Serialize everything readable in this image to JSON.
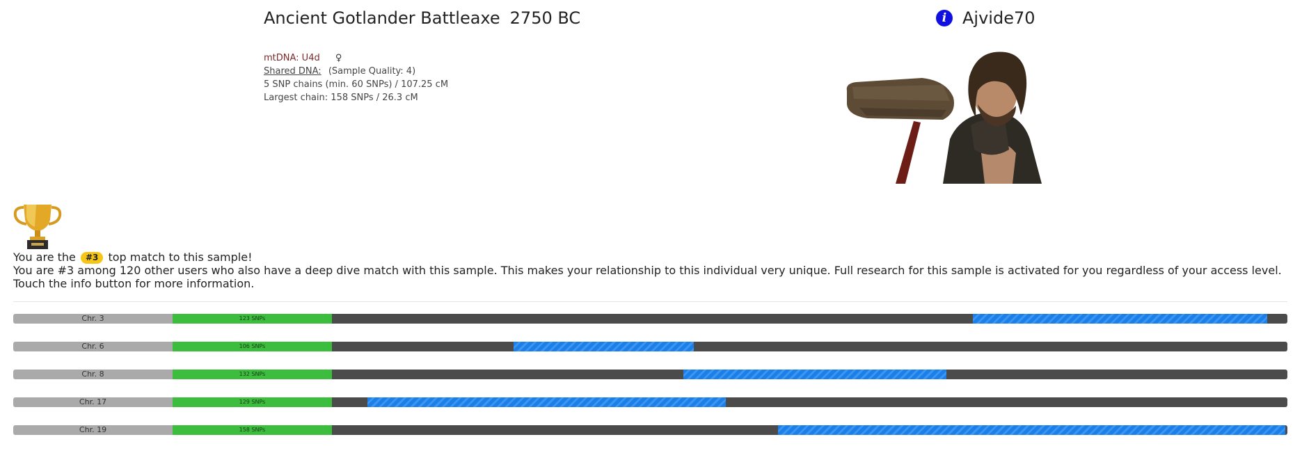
{
  "header": {
    "sample_name": "Ancient Gotlander Battleaxe",
    "sample_year": "2750 BC",
    "username": "Ajvide70",
    "info_icon": "info-icon"
  },
  "meta": {
    "mtdna": "mtDNA: U4d",
    "sex_symbol": "♀",
    "shared_dna_label": "Shared DNA:",
    "sample_quality": "(Sample Quality: 4)",
    "chains_summary": "5 SNP chains (min. 60 SNPs) / 107.25 cM",
    "largest_chain": "Largest chain: 158 SNPs / 26.3 cM"
  },
  "match": {
    "trophy_icon": "trophy-icon",
    "line1_pre": "You are the",
    "rank_badge": "#3",
    "line1_post": "top match to this sample!",
    "line2": "You are #3 among 120 other users who also have a deep dive match with this sample. This makes your relationship to this individual very unique. Full research for this sample is activated for you regardless of your access level.",
    "line3": "Touch the info button for more information."
  },
  "chromosomes": [
    {
      "label": "Chr. 3",
      "snps": "123 SNPs",
      "segment_start": 0.671,
      "segment_end": 0.979
    },
    {
      "label": "Chr. 6",
      "snps": "106 SNPs",
      "segment_start": 0.19,
      "segment_end": 0.379
    },
    {
      "label": "Chr. 8",
      "snps": "132 SNPs",
      "segment_start": 0.368,
      "segment_end": 0.643
    },
    {
      "label": "Chr. 17",
      "snps": "129 SNPs",
      "segment_start": 0.037,
      "segment_end": 0.412
    },
    {
      "label": "Chr. 19",
      "snps": "158 SNPs",
      "segment_start": 0.467,
      "segment_end": 0.998
    }
  ],
  "colors": {
    "segment_blue": "#1a7fe8",
    "snp_green": "#3dbd3d",
    "track_gray": "#4b4b4b",
    "label_gray": "#aaaaaa",
    "badge_gold": "#f5c518",
    "info_blue": "#1010e0"
  }
}
